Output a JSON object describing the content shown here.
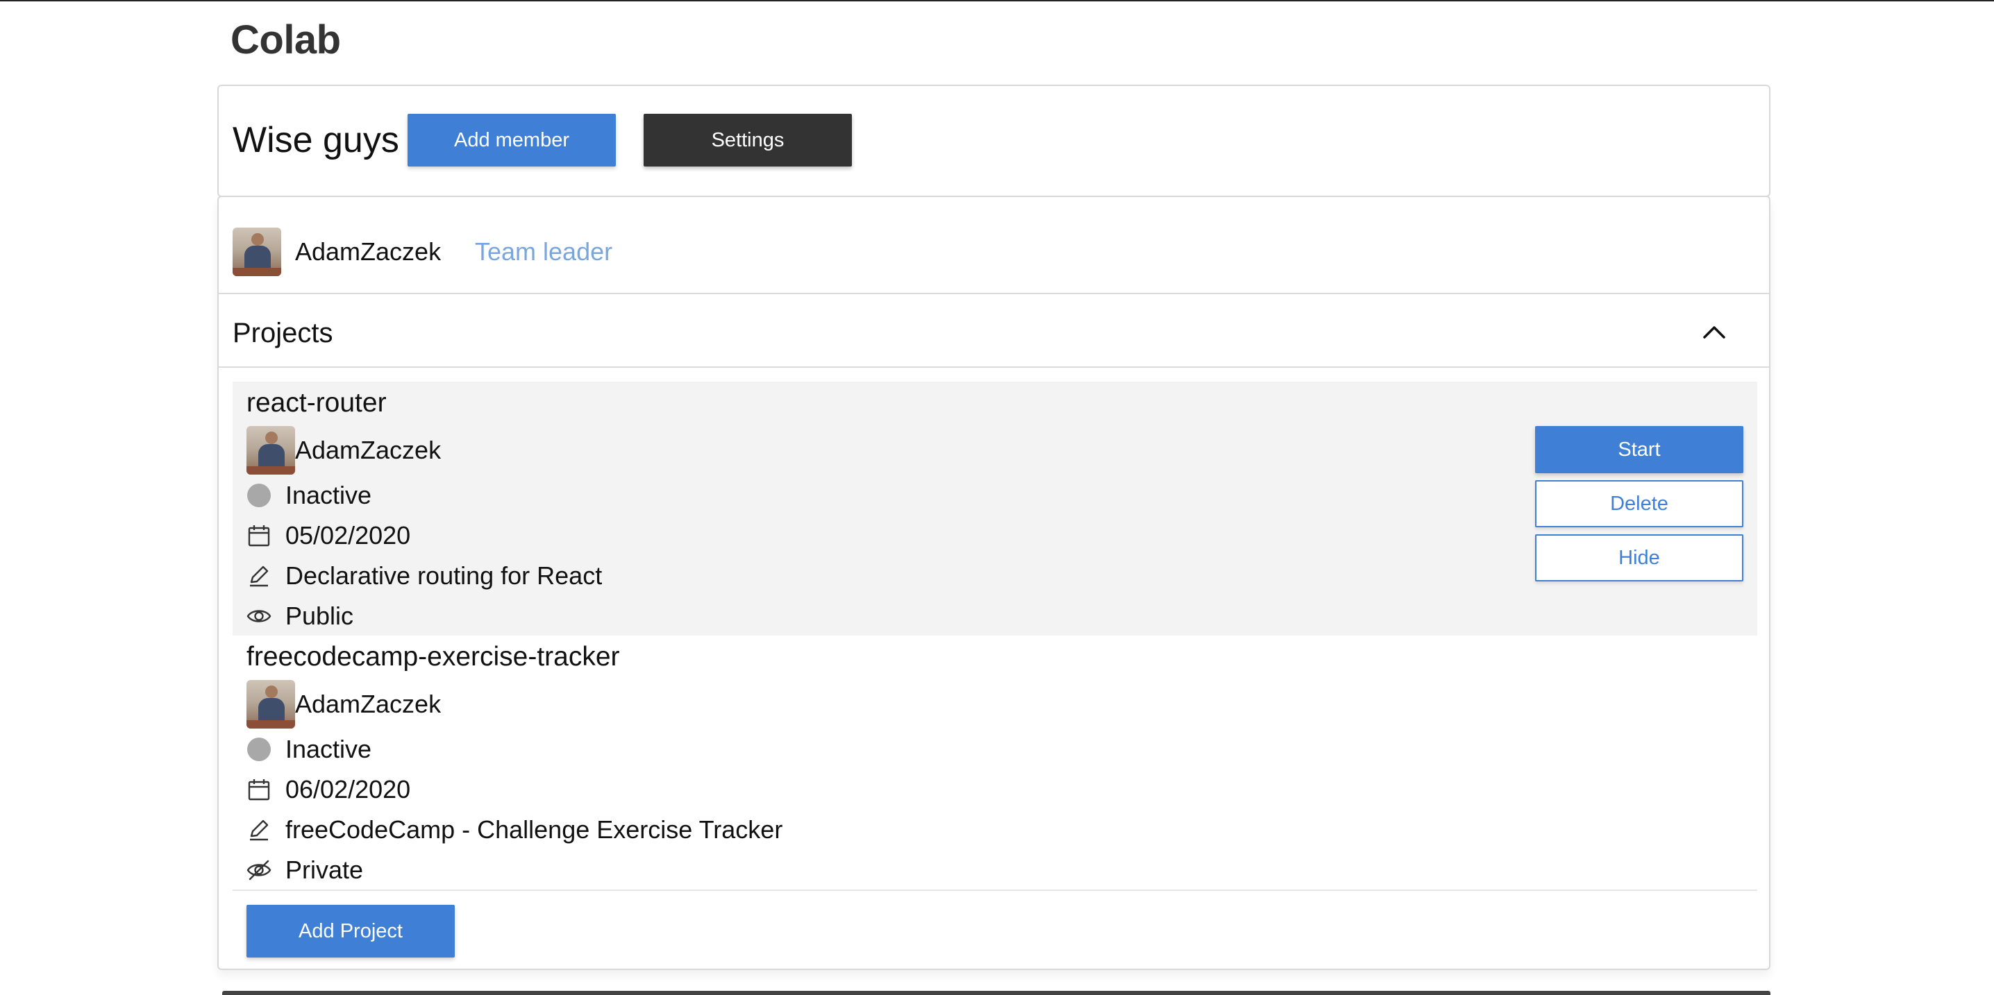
{
  "app": {
    "title": "Colab"
  },
  "team": {
    "name": "Wise guys",
    "add_member_label": "Add member",
    "settings_label": "Settings",
    "member": {
      "name": "AdamZaczek",
      "role": "Team leader"
    }
  },
  "projects_section": {
    "title": "Projects",
    "expanded": true,
    "add_project_label": "Add Project",
    "items": [
      {
        "name": "react-router",
        "owner": "AdamZaczek",
        "status": "Inactive",
        "date": "05/02/2020",
        "description": "Declarative routing for React",
        "visibility": "Public",
        "actions": {
          "start": "Start",
          "delete": "Delete",
          "hide": "Hide"
        }
      },
      {
        "name": "freecodecamp-exercise-tracker",
        "owner": "AdamZaczek",
        "status": "Inactive",
        "date": "06/02/2020",
        "description": "freeCodeCamp - Challenge Exercise Tracker",
        "visibility": "Private"
      }
    ]
  },
  "colors": {
    "accent": "#3f7fd6",
    "dark_button": "#333333",
    "role_text": "#7aa6de",
    "status_inactive": "#a8a8a8",
    "highlight_row": "#f3f3f3"
  }
}
